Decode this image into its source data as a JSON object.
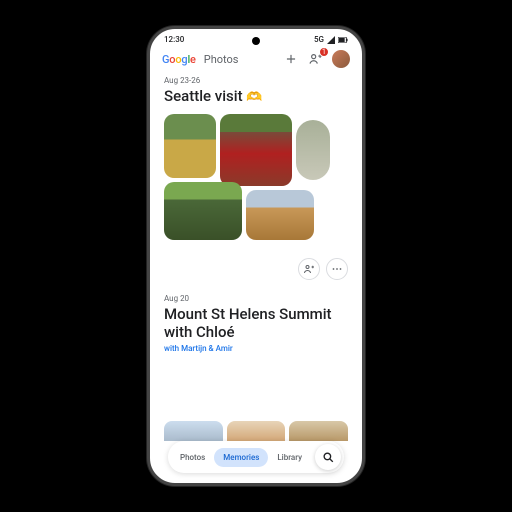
{
  "statusbar": {
    "time": "12:30",
    "network": "5G"
  },
  "brand": {
    "google": "Google",
    "app": "Photos"
  },
  "share_badge": "1",
  "memory1": {
    "date": "Aug 23-26",
    "title": "Seattle visit",
    "emoji": "🫶"
  },
  "memory2": {
    "date": "Aug 20",
    "title": "Mount St Helens Summit with Chloé",
    "with": "with Martijn & Amir"
  },
  "nav": {
    "photos": "Photos",
    "memories": "Memories",
    "library": "Library"
  }
}
